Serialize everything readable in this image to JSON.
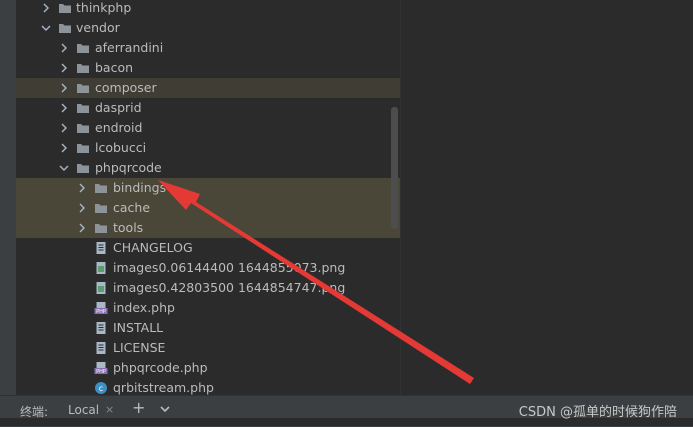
{
  "tree": {
    "rows": [
      {
        "label": "thinkphp",
        "type": "folder",
        "expanded": false
      },
      {
        "label": "vendor",
        "type": "folder",
        "expanded": true
      },
      {
        "label": "aferrandini",
        "type": "folder",
        "expanded": false
      },
      {
        "label": "bacon",
        "type": "folder",
        "expanded": false
      },
      {
        "label": "composer",
        "type": "folder",
        "expanded": false
      },
      {
        "label": "dasprid",
        "type": "folder",
        "expanded": false
      },
      {
        "label": "endroid",
        "type": "folder",
        "expanded": false
      },
      {
        "label": "lcobucci",
        "type": "folder",
        "expanded": false
      },
      {
        "label": "phpqrcode",
        "type": "folder",
        "expanded": true
      },
      {
        "label": "bindings",
        "type": "folder",
        "expanded": false
      },
      {
        "label": "cache",
        "type": "folder",
        "expanded": false
      },
      {
        "label": "tools",
        "type": "folder",
        "expanded": false
      },
      {
        "label": "CHANGELOG",
        "type": "text-file"
      },
      {
        "label": "images0.06144400 1644855073.png",
        "type": "image-file"
      },
      {
        "label": "images0.42803500 1644854747.png",
        "type": "image-file"
      },
      {
        "label": "index.php",
        "type": "php-file"
      },
      {
        "label": "INSTALL",
        "type": "text-file"
      },
      {
        "label": "LICENSE",
        "type": "text-file"
      },
      {
        "label": "phpqrcode.php",
        "type": "php-file"
      },
      {
        "label": "qrbitstream.php",
        "type": "php-class-file"
      }
    ]
  },
  "terminal_bar": {
    "label": "终端:",
    "tab_local": "Local",
    "tab_close": "×",
    "add": "+"
  },
  "watermark": "CSDN @孤单的时候狗作陪",
  "annotation": {
    "arrow_color": "#e53935"
  },
  "colors": {
    "folder": "#8c9399",
    "php_badge": "#8a6fb0",
    "highlight": "#3f3d34"
  }
}
